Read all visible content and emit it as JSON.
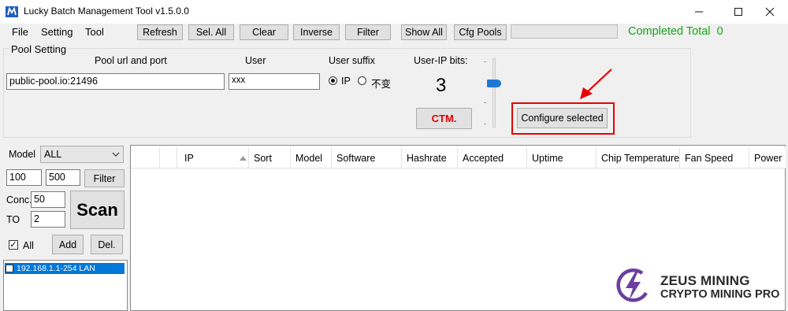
{
  "window": {
    "title": "Lucky Batch Management Tool v1.5.0.0"
  },
  "menu": [
    "File",
    "Setting",
    "Tool"
  ],
  "toolbar": {
    "buttons": [
      "Refresh",
      "Sel. All",
      "Clear",
      "Inverse",
      "Filter",
      "Show All",
      "Cfg Pools"
    ],
    "status": "Completed Total  0"
  },
  "pool": {
    "group_title": "Pool Setting",
    "url_label": "Pool url and port",
    "url_value": "public-pool.io:21496",
    "user_label": "User",
    "user_value": "xxx",
    "suffix_label": "User suffix",
    "suffix_options": [
      "IP",
      "不变"
    ],
    "suffix_selected": "IP",
    "bits_label": "User-IP bits:",
    "bits_value": "3",
    "ctm_label": "CTM.",
    "configure_label": "Configure selected"
  },
  "scan": {
    "model_label": "Model",
    "model_value": "ALL",
    "range_from": "100",
    "range_to": "500",
    "filter_label": "Filter",
    "conc_label": "Conc.",
    "conc_value": "50",
    "to_label": "TO",
    "to_value": "2",
    "scan_label": "Scan",
    "all_label": "All",
    "all_checked": true,
    "add_label": "Add",
    "del_label": "Del.",
    "ip_ranges": [
      "192.168.1.1-254 LAN"
    ]
  },
  "table": {
    "columns": [
      "IP",
      "Sort",
      "Model",
      "Software",
      "Hashrate",
      "Accepted",
      "Uptime",
      "Chip Temperature",
      "Fan Speed",
      "Power"
    ],
    "rows": []
  },
  "watermark": {
    "line1": "ZEUS MINING",
    "line2": "CRYPTO MINING PRO"
  },
  "colors": {
    "accent_green": "#17a317",
    "highlight_red": "#e80000",
    "ctm_red": "#e10000",
    "selection_blue": "#0078d7"
  }
}
